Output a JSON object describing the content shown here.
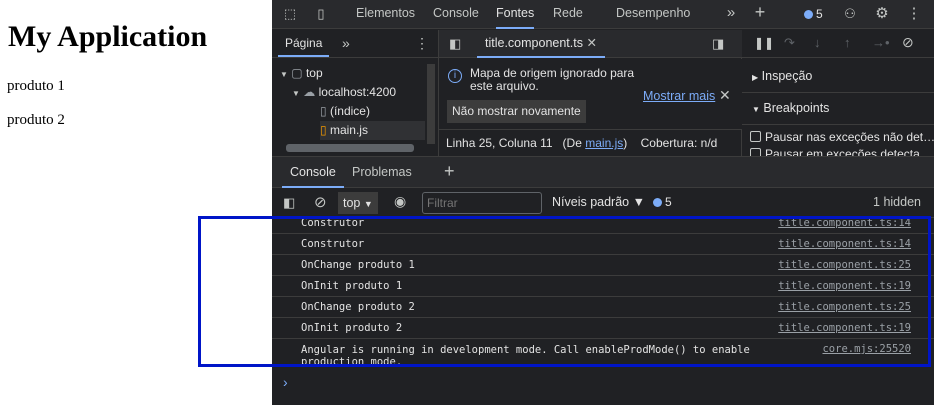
{
  "app": {
    "title": "My Application",
    "items": [
      "produto 1",
      "produto 2"
    ]
  },
  "devtools": {
    "tabs": [
      "Elementos",
      "Console",
      "Fontes",
      "Rede",
      "Desempenho"
    ],
    "active_tab": "Fontes",
    "issues_count": "5",
    "icons": [
      "inspect-icon",
      "device-toolbar-icon",
      "more-tabs-icon",
      "add-icon",
      "issues-icon",
      "customize-icon",
      "settings-icon",
      "kebab-icon"
    ]
  },
  "sources": {
    "nav_tab": "Página",
    "tree": [
      {
        "label": "top",
        "depth": 0
      },
      {
        "label": "localhost:4200",
        "depth": 1
      },
      {
        "label": "(índice)",
        "depth": 2
      },
      {
        "label": "main.js",
        "depth": 2
      }
    ],
    "editor_tab": "title.component.ts",
    "info_message": "Mapa de origem ignorado para este arquivo.",
    "learn_more": "Mostrar mais",
    "dont_show": "Não mostrar novamente",
    "status_line": "Linha 25, Coluna 11",
    "status_from_label": "(De",
    "status_from_file": "main.js",
    "status_from_close": ")",
    "coverage": "Cobertura: n/d"
  },
  "debugger": {
    "sections": [
      "Inspeção",
      "Breakpoints"
    ],
    "checkboxes": [
      "Pausar nas exceções não det…",
      "Pausar em exceções detecta…"
    ]
  },
  "console": {
    "drawer_tabs": [
      "Console",
      "Problemas"
    ],
    "context": "top",
    "filter_placeholder": "Filtrar",
    "levels": "Níveis padrão ▼",
    "issues_count": "5",
    "hidden": "1 hidden",
    "messages": [
      {
        "text": "Construtor",
        "source": "title.component.ts:14"
      },
      {
        "text": "Construtor",
        "source": "title.component.ts:14"
      },
      {
        "text": "OnChange produto 1",
        "source": "title.component.ts:25"
      },
      {
        "text": "OnInit produto 1",
        "source": "title.component.ts:19"
      },
      {
        "text": "OnChange produto 2",
        "source": "title.component.ts:25"
      },
      {
        "text": "OnInit produto 2",
        "source": "title.component.ts:19"
      },
      {
        "text": "Angular is running in development mode. Call enableProdMode() to enable production mode.",
        "source": "core.mjs:25520"
      }
    ],
    "prompt": "›"
  },
  "colors": {
    "highlight_box": "#0015c8",
    "link": "#7cacf8",
    "panel_bg": "#202124"
  }
}
